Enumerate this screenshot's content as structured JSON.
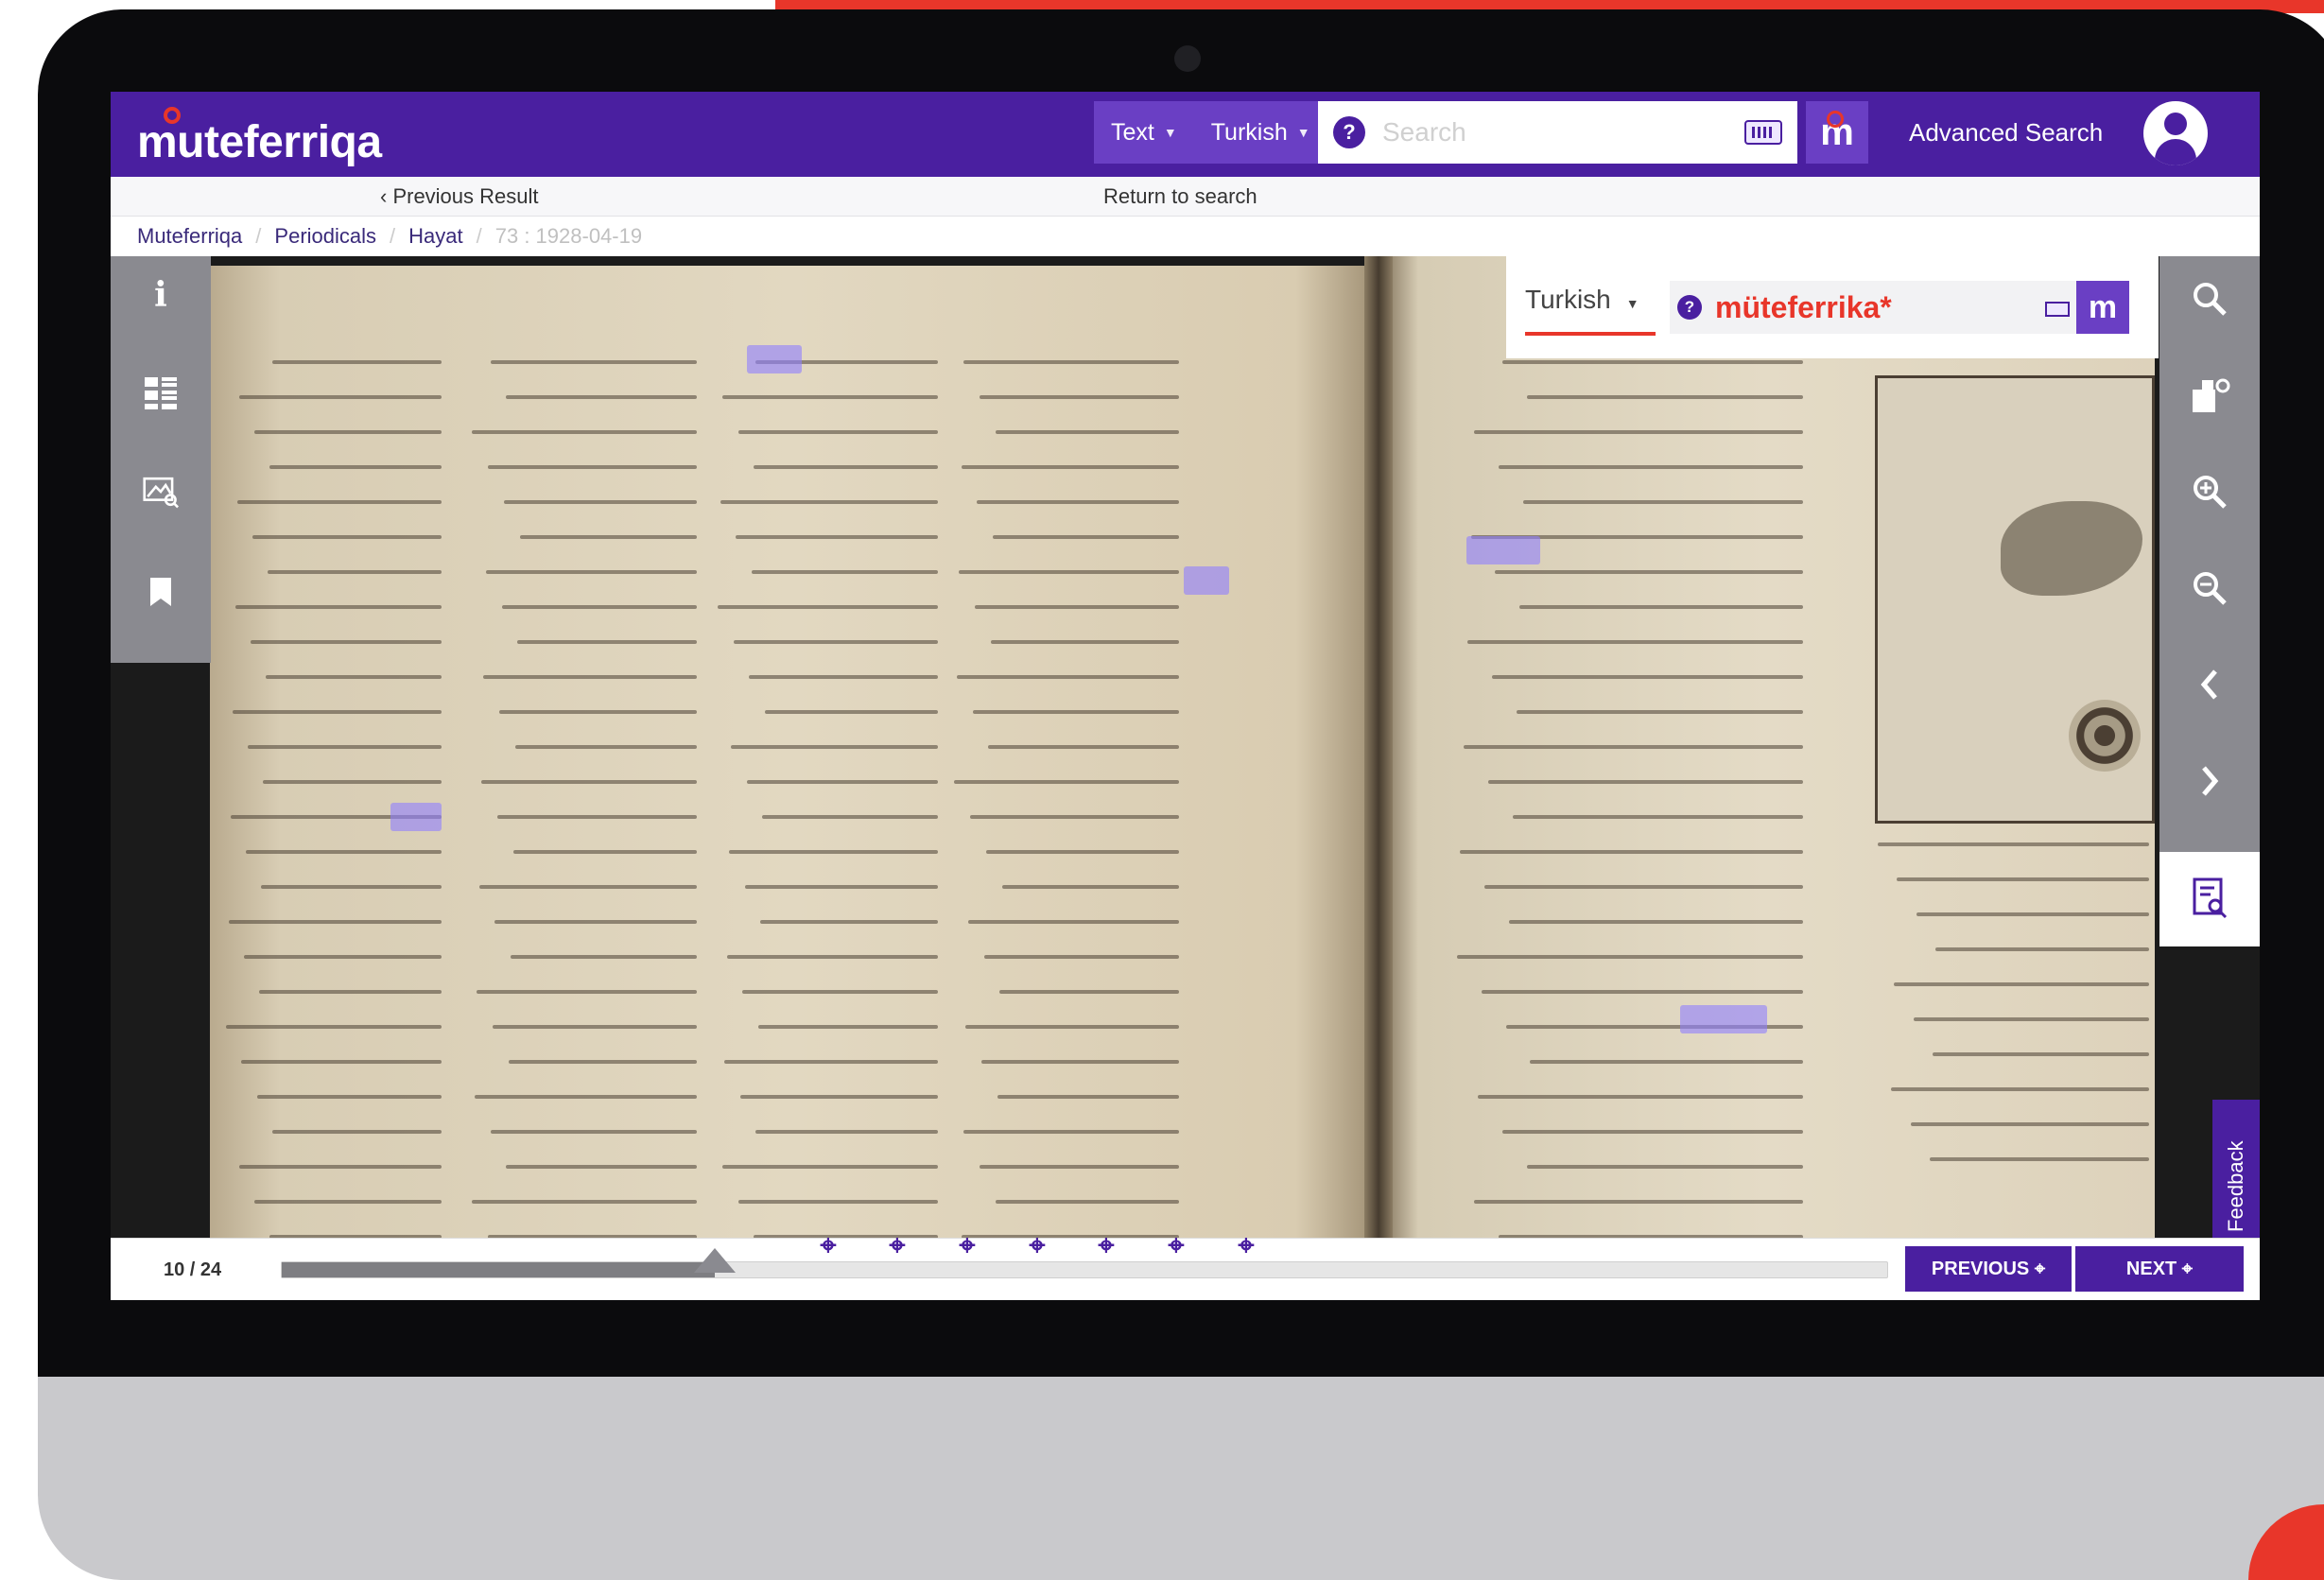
{
  "app": {
    "logo": "muteferriqa",
    "accent": "#4a1fa0",
    "brand_red": "#e8362a"
  },
  "header": {
    "scope_label": "Text",
    "language_label": "Turkish",
    "search_placeholder": "Search",
    "advanced_search": "Advanced Search",
    "m_button": "m"
  },
  "nav": {
    "previous_result": "‹ Previous Result",
    "return_to_search": "Return to search"
  },
  "breadcrumb": {
    "items": [
      "Muteferriqa",
      "Periodicals",
      "Hayat",
      "73 : 1928-04-19"
    ]
  },
  "doc_search": {
    "language": "Turkish",
    "term": "müteferrika*"
  },
  "viewer": {
    "feedback": "Feedback"
  },
  "pager": {
    "page_indicator": "10 / 24",
    "progress_fraction": 0.27,
    "previous_label": "PREVIOUS ⌖",
    "next_label": "NEXT ⌖"
  },
  "icons": {
    "left_rail": [
      "info-icon",
      "thumbnails-icon",
      "image-search-icon",
      "bookmark-icon"
    ],
    "right_rail": [
      "search-icon",
      "share-icon",
      "zoom-in-icon",
      "zoom-out-icon",
      "chevron-left-icon",
      "chevron-right-icon",
      "page-search-icon"
    ]
  }
}
